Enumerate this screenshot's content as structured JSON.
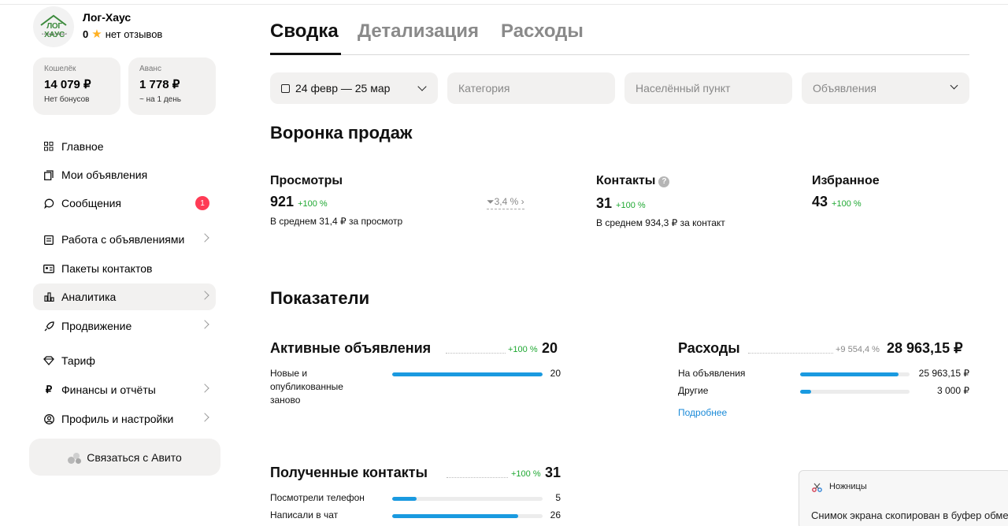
{
  "profile": {
    "name": "Лог-Хаус",
    "rating": "0",
    "reviews": "нет отзывов",
    "logo_text": "ЛОГ ХАУС",
    "logo_sub": "в согласии с природой"
  },
  "wallet": {
    "label": "Кошелёк",
    "amount": "14 079 ₽",
    "sub": "Нет бонусов"
  },
  "advance": {
    "label": "Аванс",
    "amount": "1 778 ₽",
    "sub": "~ на 1 день"
  },
  "nav": {
    "items": [
      {
        "label": "Главное"
      },
      {
        "label": "Мои объявления"
      },
      {
        "label": "Сообщения",
        "badge": "1"
      },
      {
        "label": "Работа с объявлениями"
      },
      {
        "label": "Пакеты контактов"
      },
      {
        "label": "Аналитика"
      },
      {
        "label": "Продвижение"
      },
      {
        "label": "Тариф"
      },
      {
        "label": "Финансы и отчёты"
      },
      {
        "label": "Профиль и настройки"
      }
    ],
    "contact_avito": "Связаться с Авито"
  },
  "tabs": [
    {
      "label": "Сводка"
    },
    {
      "label": "Детализация"
    },
    {
      "label": "Расходы"
    }
  ],
  "filters": {
    "date": "24 февр — 25 мар",
    "category": "Категория",
    "locality": "Населённый пункт",
    "listings": "Объявления"
  },
  "funnel": {
    "title": "Воронка продаж",
    "views": {
      "title": "Просмотры",
      "value": "921",
      "delta": "+100 %",
      "sub": "В среднем 31,4 ₽ за просмотр"
    },
    "conversion": "3,4 %",
    "contacts": {
      "title": "Контакты",
      "value": "31",
      "delta": "+100 %",
      "sub": "В среднем 934,3 ₽ за контакт"
    },
    "favorites": {
      "title": "Избранное",
      "value": "43",
      "delta": "+100 %"
    }
  },
  "indicators": {
    "title": "Показатели",
    "active": {
      "title": "Активные объявления",
      "delta": "+100 %",
      "value": "20",
      "rows": [
        {
          "label": "Новые и опубликованные заново",
          "value": "20",
          "fraction": 1.0
        }
      ]
    },
    "expenses": {
      "title": "Расходы",
      "delta": "+9 554,4 %",
      "value": "28 963,15 ₽",
      "rows": [
        {
          "label": "На объявления",
          "value": "25 963,15 ₽",
          "fraction": 0.9
        },
        {
          "label": "Другие",
          "value": "3 000 ₽",
          "fraction": 0.1
        }
      ],
      "more": "Подробнее"
    },
    "contacts": {
      "title": "Полученные контакты",
      "delta": "+100 %",
      "value": "31",
      "rows": [
        {
          "label": "Посмотрели телефон",
          "value": "5",
          "fraction": 0.16
        },
        {
          "label": "Написали в чат",
          "value": "26",
          "fraction": 0.84
        }
      ]
    }
  },
  "toast": {
    "app": "Ножницы",
    "message": "Снимок экрана скопирован в буфер обме"
  }
}
